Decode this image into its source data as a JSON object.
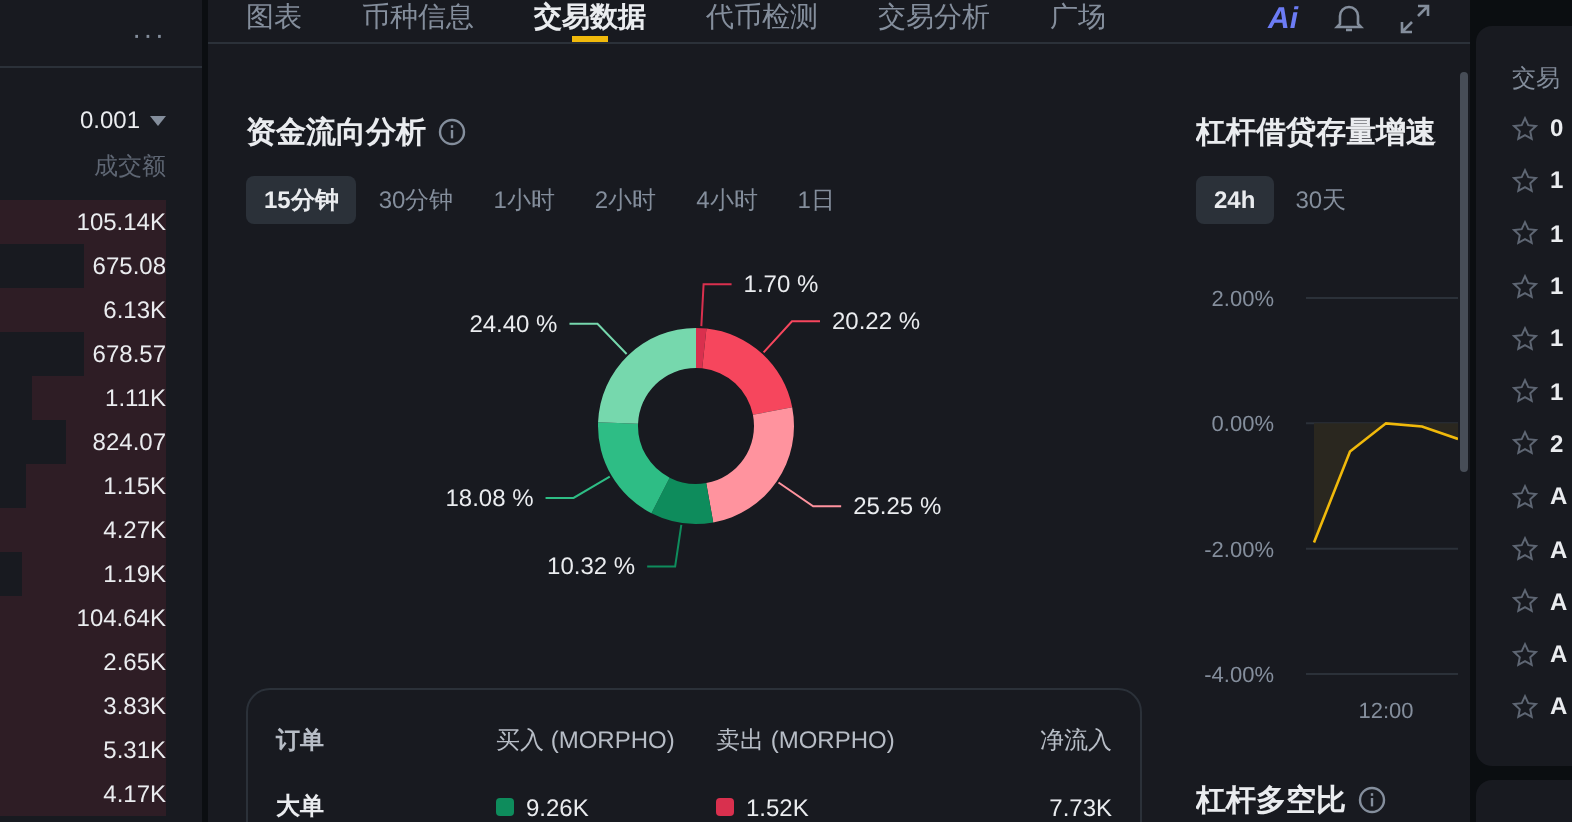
{
  "orderbook": {
    "menu": "···",
    "precision": "0.001",
    "column": "成交额",
    "rows": [
      {
        "amount": "105.14K"
      },
      {
        "amount": "675.08"
      },
      {
        "amount": "6.13K"
      },
      {
        "amount": "678.57"
      },
      {
        "amount": "1.11K"
      },
      {
        "amount": "824.07"
      },
      {
        "amount": "1.15K"
      },
      {
        "amount": "4.27K"
      },
      {
        "amount": "1.19K"
      },
      {
        "amount": "104.64K"
      },
      {
        "amount": "2.65K"
      },
      {
        "amount": "3.83K"
      },
      {
        "amount": "5.31K"
      },
      {
        "amount": "4.17K"
      }
    ]
  },
  "tabs": [
    {
      "label": "图表",
      "selected": false
    },
    {
      "label": "币种信息",
      "selected": false
    },
    {
      "label": "交易数据",
      "selected": true
    },
    {
      "label": "代币检测",
      "selected": false
    },
    {
      "label": "交易分析",
      "selected": false
    },
    {
      "label": "广场",
      "selected": false
    }
  ],
  "toolbar": {
    "ai_label": "Ai"
  },
  "fund_flow": {
    "title": "资金流向分析",
    "periods": [
      {
        "label": "15分钟",
        "selected": true
      },
      {
        "label": "30分钟",
        "selected": false
      },
      {
        "label": "1小时",
        "selected": false
      },
      {
        "label": "2小时",
        "selected": false
      },
      {
        "label": "4小时",
        "selected": false
      },
      {
        "label": "1日",
        "selected": false
      }
    ],
    "chart_data": {
      "type": "donut",
      "values": [
        1.7,
        20.22,
        25.25,
        10.32,
        18.08,
        24.4
      ],
      "colors": [
        "#d9304e",
        "#f6465d",
        "#ff939e",
        "#0e8c5c",
        "#2ebd85",
        "#76d8ad"
      ],
      "value_labels": [
        "1.70 %",
        "20.22 %",
        "25.25 %",
        "10.32 %",
        "18.08 %",
        "24.40 %"
      ]
    },
    "table": {
      "columns": [
        "订单",
        "买入 (MORPHO)",
        "卖出 (MORPHO)",
        "净流入"
      ],
      "rows": [
        {
          "order": "大单",
          "buy": "9.26K",
          "sell": "1.52K",
          "net": "7.73K"
        }
      ]
    }
  },
  "margin_growth": {
    "title": "杠杆借贷存量增速",
    "periods": [
      {
        "label": "24h",
        "selected": true
      },
      {
        "label": "30天",
        "selected": false
      }
    ],
    "time_label": "12:00",
    "chart_data": {
      "type": "line",
      "categories": [
        null,
        null,
        null,
        null,
        null
      ],
      "series": [
        {
          "color": "#f0b90b",
          "values": [
            -1.9,
            -0.45,
            0,
            -0.05,
            -0.25
          ]
        }
      ],
      "ylim": [
        -4,
        2
      ],
      "yticks": [
        {
          "value": 2,
          "label": "2.00%"
        },
        {
          "value": 0,
          "label": "0.00%"
        },
        {
          "value": -2,
          "label": "-2.00%"
        },
        {
          "value": -4,
          "label": "-4.00%"
        }
      ]
    }
  },
  "long_short": {
    "title": "杠杆多空比"
  },
  "pairs": {
    "header": "交易",
    "rows": [
      "0",
      "1",
      "1",
      "1",
      "1",
      "1",
      "2",
      "A",
      "A",
      "A",
      "A",
      "A"
    ]
  }
}
